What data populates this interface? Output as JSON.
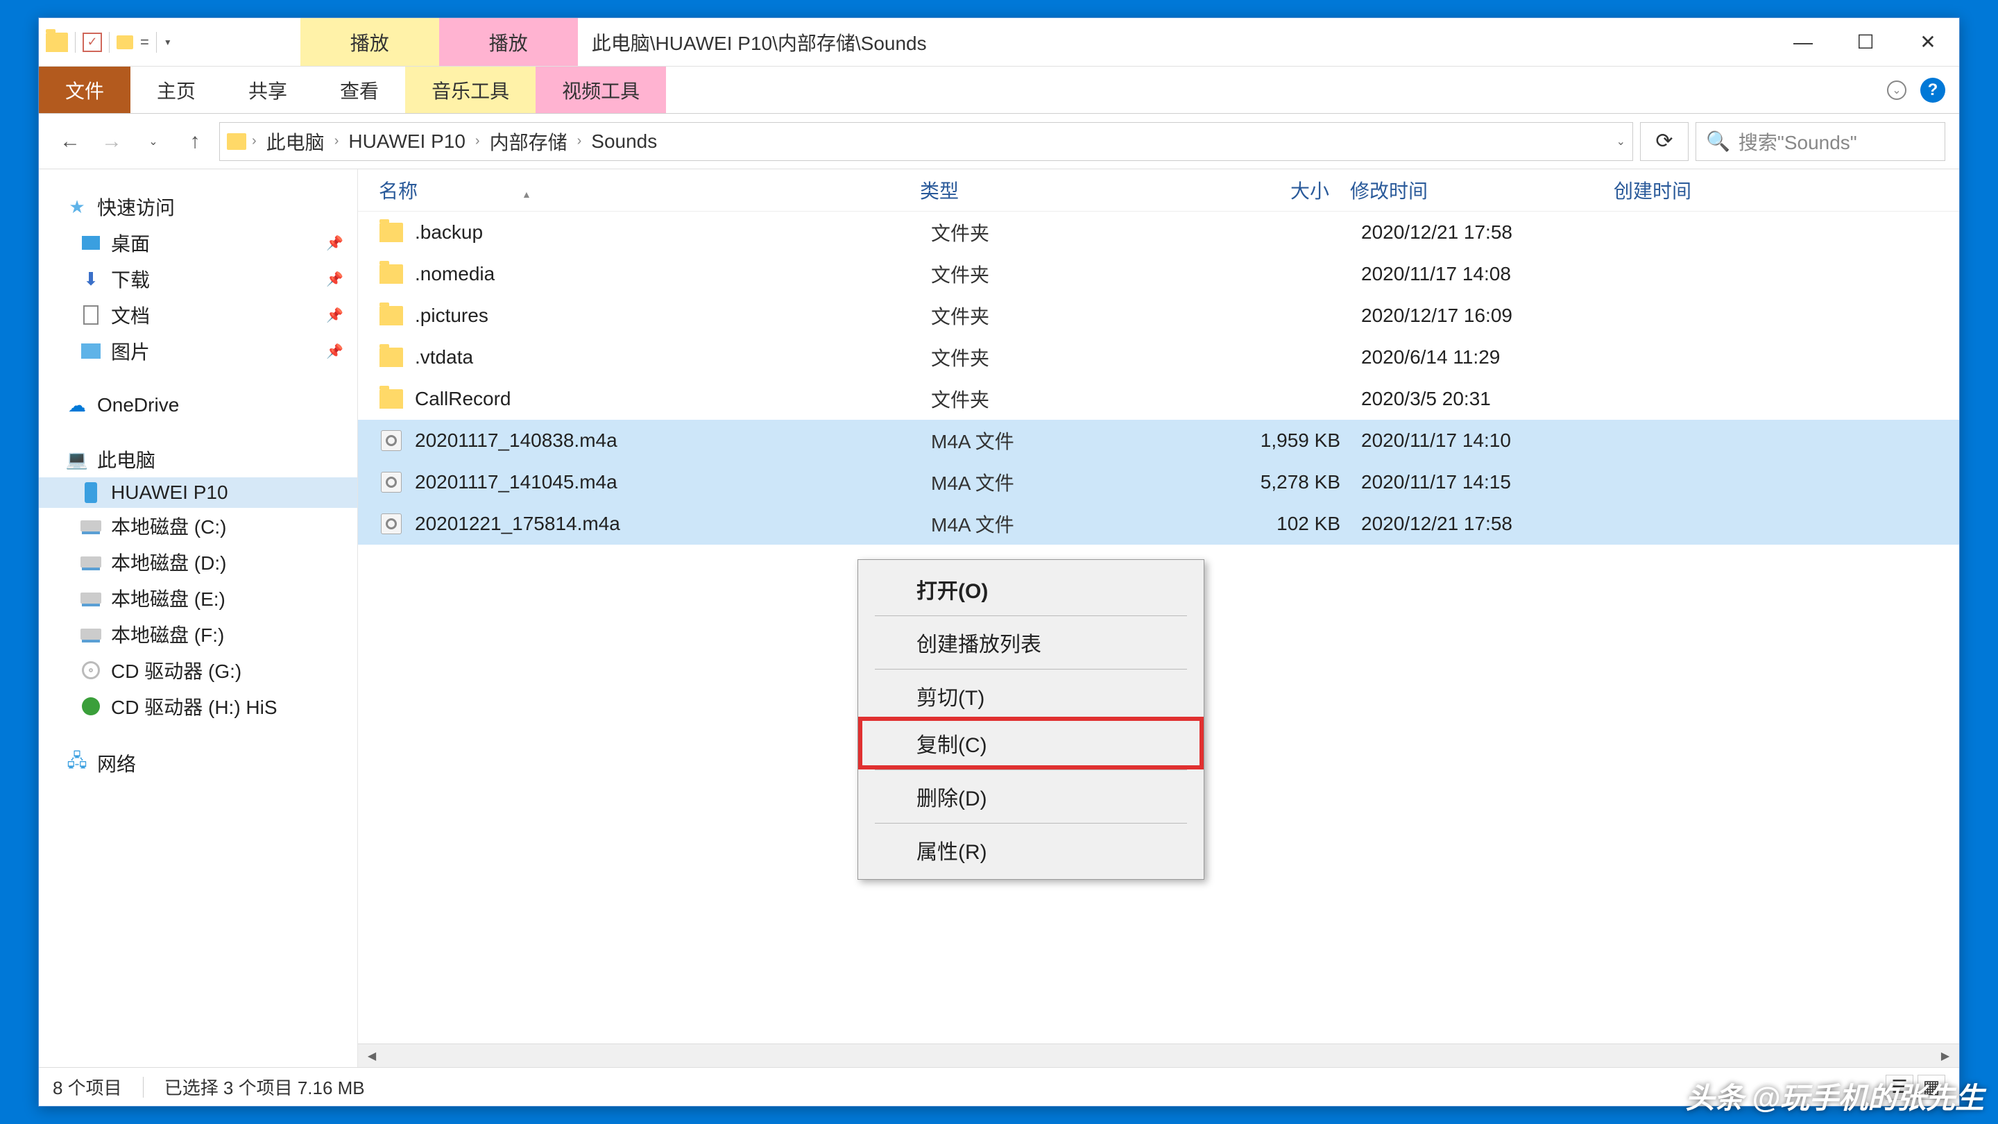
{
  "title_path": "此电脑\\HUAWEI P10\\内部存储\\Sounds",
  "context_tabs": {
    "play1": "播放",
    "play2": "播放"
  },
  "ribbon": {
    "file": "文件",
    "home": "主页",
    "share": "共享",
    "view": "查看",
    "music_tools": "音乐工具",
    "video_tools": "视频工具"
  },
  "breadcrumbs": [
    "此电脑",
    "HUAWEI P10",
    "内部存储",
    "Sounds"
  ],
  "search_placeholder": "搜索\"Sounds\"",
  "sidebar": {
    "quick_access": "快速访问",
    "desktop": "桌面",
    "downloads": "下载",
    "documents": "文档",
    "pictures": "图片",
    "onedrive": "OneDrive",
    "this_pc": "此电脑",
    "phone": "HUAWEI P10",
    "drive_c": "本地磁盘 (C:)",
    "drive_d": "本地磁盘 (D:)",
    "drive_e": "本地磁盘 (E:)",
    "drive_f": "本地磁盘 (F:)",
    "cd_g": "CD 驱动器 (G:)",
    "cd_h": "CD 驱动器 (H:) HiS",
    "network": "网络"
  },
  "columns": {
    "name": "名称",
    "type": "类型",
    "size": "大小",
    "modified": "修改时间",
    "created": "创建时间"
  },
  "files": [
    {
      "name": ".backup",
      "type": "文件夹",
      "size": "",
      "modified": "2020/12/21 17:58",
      "icon": "folder",
      "selected": false
    },
    {
      "name": ".nomedia",
      "type": "文件夹",
      "size": "",
      "modified": "2020/11/17 14:08",
      "icon": "folder",
      "selected": false
    },
    {
      "name": ".pictures",
      "type": "文件夹",
      "size": "",
      "modified": "2020/12/17 16:09",
      "icon": "folder",
      "selected": false
    },
    {
      "name": ".vtdata",
      "type": "文件夹",
      "size": "",
      "modified": "2020/6/14 11:29",
      "icon": "folder",
      "selected": false
    },
    {
      "name": "CallRecord",
      "type": "文件夹",
      "size": "",
      "modified": "2020/3/5 20:31",
      "icon": "folder",
      "selected": false
    },
    {
      "name": "20201117_140838.m4a",
      "type": "M4A 文件",
      "size": "1,959 KB",
      "modified": "2020/11/17 14:10",
      "icon": "m4a",
      "selected": true
    },
    {
      "name": "20201117_141045.m4a",
      "type": "M4A 文件",
      "size": "5,278 KB",
      "modified": "2020/11/17 14:15",
      "icon": "m4a",
      "selected": true
    },
    {
      "name": "20201221_175814.m4a",
      "type": "M4A 文件",
      "size": "102 KB",
      "modified": "2020/12/21 17:58",
      "icon": "m4a",
      "selected": true
    }
  ],
  "context_menu": {
    "open": "打开(O)",
    "create_playlist": "创建播放列表",
    "cut": "剪切(T)",
    "copy": "复制(C)",
    "delete": "删除(D)",
    "properties": "属性(R)"
  },
  "status": {
    "item_count": "8 个项目",
    "selection": "已选择 3 个项目 7.16 MB"
  },
  "watermark": "头条 @玩手机的张先生"
}
